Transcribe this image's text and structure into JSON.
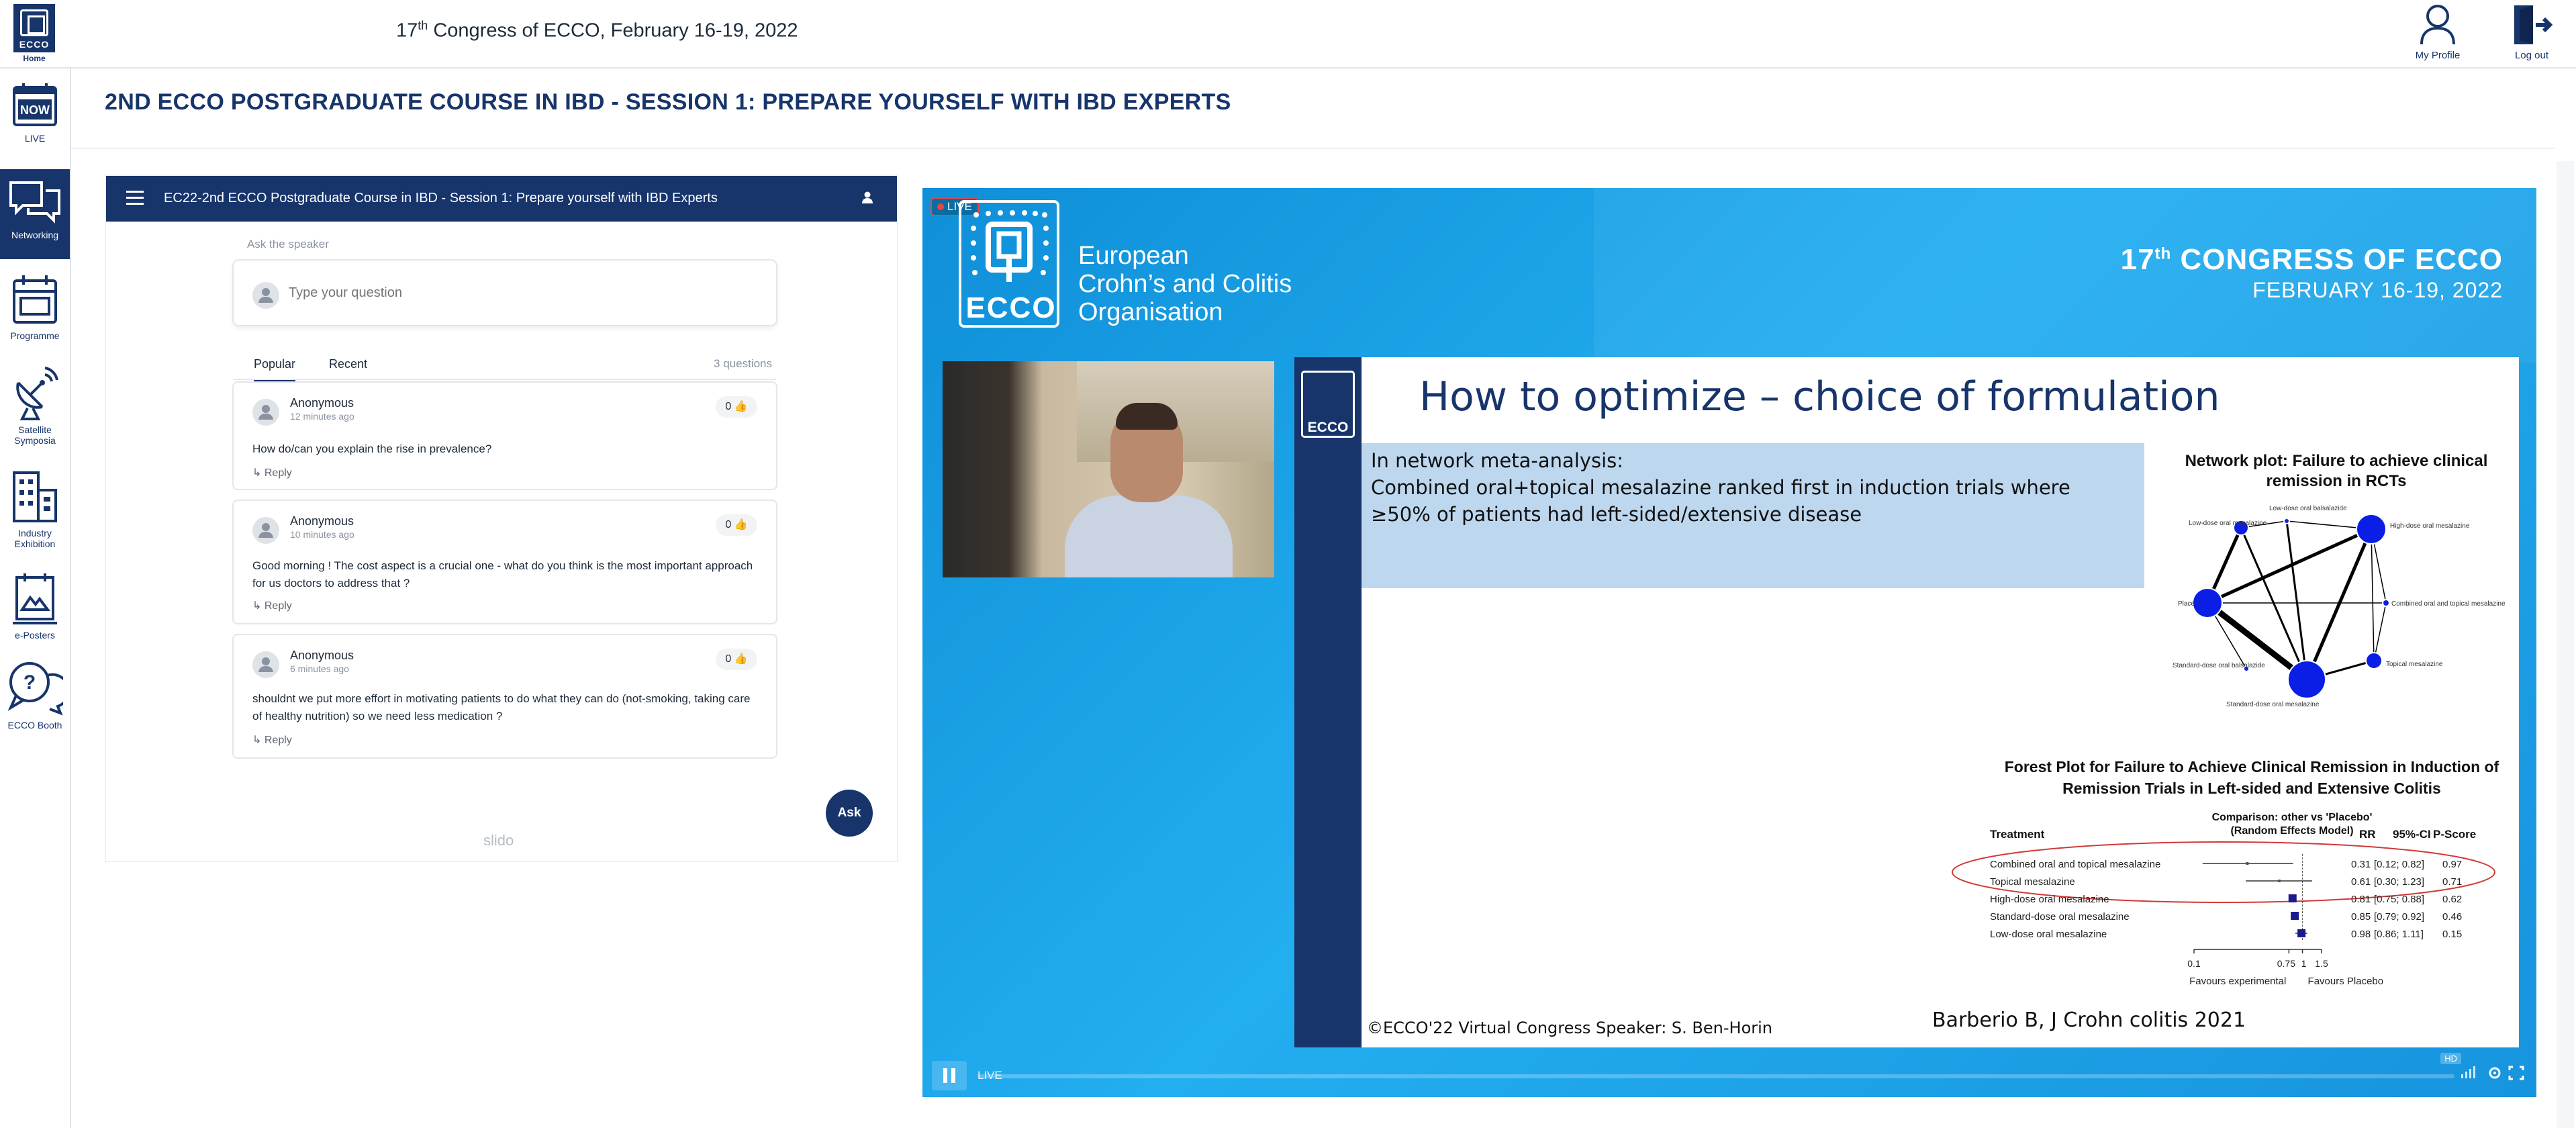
{
  "header": {
    "home_label": "Home",
    "logo_word": "ECCO",
    "congress_prefix": "17",
    "congress_sup": "th",
    "congress_suffix": " Congress of ECCO, February 16-19, 2022",
    "profile_label": "My Profile",
    "logout_label": "Log out"
  },
  "sidebar": {
    "items": [
      {
        "label": "LIVE",
        "icon": "now-icon",
        "badge": "NOW",
        "active": false
      },
      {
        "label": "Networking",
        "icon": "chat-bubbles-icon",
        "active": true
      },
      {
        "label": "Programme",
        "icon": "calendar-icon",
        "active": false
      },
      {
        "label": "Satellite Symposia",
        "icon": "satellite-dish-icon",
        "active": false
      },
      {
        "label": "Industry Exhibition",
        "icon": "buildings-icon",
        "active": false
      },
      {
        "label": "e-Posters",
        "icon": "poster-icon",
        "active": false
      },
      {
        "label": "ECCO Booth",
        "icon": "question-bubbles-icon",
        "active": false
      }
    ]
  },
  "page": {
    "title": "2ND ECCO POSTGRADUATE COURSE IN IBD - SESSION 1: PREPARE YOURSELF WITH IBD EXPERTS"
  },
  "slido": {
    "header_title": "EC22-2nd ECCO Postgraduate Course in IBD - Session 1: Prepare yourself with IBD Experts",
    "ask_label": "Ask the speaker",
    "input_placeholder": "Type your question",
    "tabs": [
      "Popular",
      "Recent"
    ],
    "question_count": "3 questions",
    "reply_label": "Reply",
    "ask_button": "Ask",
    "brand": "slido",
    "questions": [
      {
        "author": "Anonymous",
        "time": "12 minutes ago",
        "likes": "0",
        "text": "How do/can you explain the rise in prevalence?"
      },
      {
        "author": "Anonymous",
        "time": "10 minutes ago",
        "likes": "0",
        "text": "Good morning ! The cost aspect is a crucial one - what do you think is the most important approach for us doctors to address that ?"
      },
      {
        "author": "Anonymous",
        "time": "6 minutes ago",
        "likes": "0",
        "text": "shouldnt we put more effort in motivating patients to do what they can do (not-smoking, taking care of healthy nutrition) so we need less medication ?"
      }
    ]
  },
  "video": {
    "live_badge": "LIVE",
    "org_name_lines": [
      "European",
      "Crohn’s and Colitis",
      "Organisation"
    ],
    "logo_word": "ECCO",
    "congress_l1_prefix": "17",
    "congress_l1_sup": "th",
    "congress_l1_suffix": " CONGRESS OF ECCO",
    "congress_l2": "FEBRUARY 16-19, 2022",
    "controls_live": "LIVE",
    "quality": "HD"
  },
  "slide": {
    "logo_word": "ECCO",
    "title": "How to optimize – choice of formulation",
    "meta_line1": "In network meta-analysis:",
    "meta_line2": "Combined oral+topical mesalazine ranked first in induction trials where ≥50% of patients had left-sided/extensive disease",
    "network_title": "Network plot: Failure to achieve clinical remission in RCTs",
    "network_nodes": [
      {
        "label": "Low-dose oral mesalazine",
        "size": "small"
      },
      {
        "label": "Low-dose oral balsalazide",
        "size": "tiny"
      },
      {
        "label": "High-dose oral mesalazine",
        "size": "large"
      },
      {
        "label": "Combined oral and topical mesalazine",
        "size": "tiny"
      },
      {
        "label": "Topical mesalazine",
        "size": "small"
      },
      {
        "label": "Standard-dose oral mesalazine",
        "size": "large"
      },
      {
        "label": "Standard-dose oral balsalazide",
        "size": "tiny"
      },
      {
        "label": "Placebo",
        "size": "large"
      }
    ],
    "forest_title": "Forest Plot for Failure to Achieve Clinical Remission in Induction of Remission Trials in Left-sided and Extensive Colitis",
    "forest_header_comparison": "Comparison: other vs 'Placebo'",
    "forest_header_model": "(Random Effects Model)",
    "forest_col_treatment": "Treatment",
    "forest_col_rr": "RR",
    "forest_col_ci": "95%-CI",
    "forest_col_pscore": "P-Score",
    "forest_axis_ticks": [
      "0.1",
      "0.75",
      "1",
      "1.5"
    ],
    "forest_axis_left": "Favours experimental",
    "forest_axis_right": "Favours Placebo",
    "copyright": "©ECCO'22 Virtual Congress  Speaker:  S. Ben-Horin",
    "reference": "Barberio B, J Crohn colitis 2021"
  },
  "chart_data": {
    "type": "forest",
    "title": "Forest Plot for Failure to Achieve Clinical Remission in Induction of Remission Trials in Left-sided and Extensive Colitis",
    "xscale": "log",
    "xlim": [
      0.1,
      1.5
    ],
    "reference_line": 1,
    "rows": [
      {
        "treatment": "Combined oral and topical mesalazine",
        "rr": 0.31,
        "ci": [
          0.12,
          0.82
        ],
        "ci_text": "[0.12; 0.82]",
        "pscore": "0.97",
        "highlighted": true
      },
      {
        "treatment": "Topical mesalazine",
        "rr": 0.61,
        "ci": [
          0.3,
          1.23
        ],
        "ci_text": "[0.30; 1.23]",
        "pscore": "0.71",
        "highlighted": true
      },
      {
        "treatment": "High-dose oral mesalazine",
        "rr": 0.81,
        "ci": [
          0.75,
          0.88
        ],
        "ci_text": "[0.75; 0.88]",
        "pscore": "0.62",
        "highlighted": false
      },
      {
        "treatment": "Standard-dose oral mesalazine",
        "rr": 0.85,
        "ci": [
          0.79,
          0.92
        ],
        "ci_text": "[0.79; 0.92]",
        "pscore": "0.46",
        "highlighted": false
      },
      {
        "treatment": "Low-dose oral mesalazine",
        "rr": 0.98,
        "ci": [
          0.86,
          1.11
        ],
        "ci_text": "[0.86; 1.11]",
        "pscore": "0.15",
        "highlighted": false
      }
    ]
  },
  "colors": {
    "brand_navy": "#17356b",
    "video_blue": "#1b9ee8",
    "slide_box": "#bdd7ee",
    "node_blue": "#0a1ee6",
    "highlight_red": "#d03a3a"
  }
}
